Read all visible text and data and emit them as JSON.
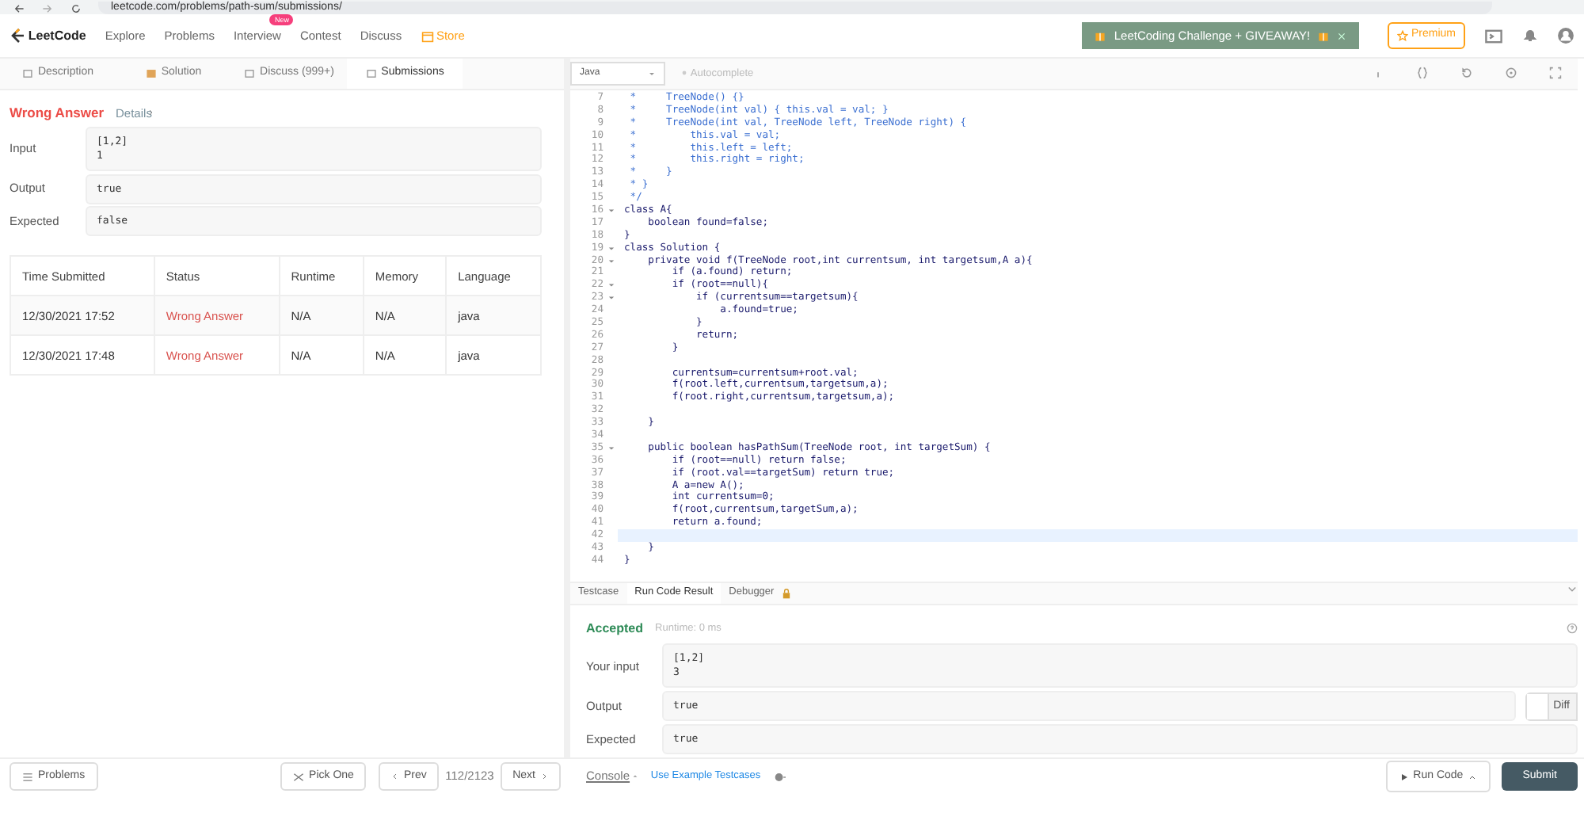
{
  "browser": {
    "url": "leetcode.com/problems/path-sum/submissions/"
  },
  "navbar": {
    "logo": "LeetCode",
    "items": [
      {
        "label": "Explore"
      },
      {
        "label": "Problems"
      },
      {
        "label": "Interview",
        "badge": "New"
      },
      {
        "label": "Contest"
      },
      {
        "label": "Discuss"
      },
      {
        "label": "Store",
        "kind": "store"
      }
    ],
    "banner": "LeetCoding Challenge + GIVEAWAY!",
    "premium": "Premium"
  },
  "tabs": [
    {
      "label": "Description",
      "selected": false
    },
    {
      "label": "Solution",
      "selected": false
    },
    {
      "label": "Discuss (999+)",
      "selected": false
    },
    {
      "label": "Submissions",
      "selected": true
    }
  ],
  "result": {
    "status": "Wrong Answer",
    "details": "Details",
    "fields": [
      {
        "label": "Input",
        "value": "[1,2]\n1"
      },
      {
        "label": "Output",
        "value": "true"
      },
      {
        "label": "Expected",
        "value": "false"
      }
    ]
  },
  "submissions": {
    "columns": [
      "Time Submitted",
      "Status",
      "Runtime",
      "Memory",
      "Language"
    ],
    "rows": [
      {
        "time": "12/30/2021 17:52",
        "status": "Wrong Answer",
        "runtime": "N/A",
        "memory": "N/A",
        "language": "java"
      },
      {
        "time": "12/30/2021 17:48",
        "status": "Wrong Answer",
        "runtime": "N/A",
        "memory": "N/A",
        "language": "java"
      }
    ]
  },
  "editor": {
    "language": "Java",
    "autocomplete": "Autocomplete",
    "lines": [
      {
        "number": "7",
        "kind": "comment",
        "text": " *     TreeNode() {}",
        "foldable": false,
        "active": false
      },
      {
        "number": "8",
        "kind": "comment",
        "text": " *     TreeNode(int val) { this.val = val; }",
        "foldable": false,
        "active": false
      },
      {
        "number": "9",
        "kind": "comment",
        "text": " *     TreeNode(int val, TreeNode left, TreeNode right) {",
        "foldable": false,
        "active": false
      },
      {
        "number": "10",
        "kind": "comment",
        "text": " *         this.val = val;",
        "foldable": false,
        "active": false
      },
      {
        "number": "11",
        "kind": "comment",
        "text": " *         this.left = left;",
        "foldable": false,
        "active": false
      },
      {
        "number": "12",
        "kind": "comment",
        "text": " *         this.right = right;",
        "foldable": false,
        "active": false
      },
      {
        "number": "13",
        "kind": "comment",
        "text": " *     }",
        "foldable": false,
        "active": false
      },
      {
        "number": "14",
        "kind": "comment",
        "text": " * }",
        "foldable": false,
        "active": false
      },
      {
        "number": "15",
        "kind": "comment",
        "text": " */",
        "foldable": false,
        "active": false
      },
      {
        "number": "16",
        "kind": "code",
        "text": "class A{",
        "foldable": true,
        "active": false
      },
      {
        "number": "17",
        "kind": "code",
        "text": "    boolean found=false;",
        "foldable": false,
        "active": false
      },
      {
        "number": "18",
        "kind": "code",
        "text": "}",
        "foldable": false,
        "active": false
      },
      {
        "number": "19",
        "kind": "code",
        "text": "class Solution {",
        "foldable": true,
        "active": false
      },
      {
        "number": "20",
        "kind": "code",
        "text": "    private void f(TreeNode root,int currentsum, int targetsum,A a){",
        "foldable": true,
        "active": false
      },
      {
        "number": "21",
        "kind": "code",
        "text": "        if (a.found) return;",
        "foldable": false,
        "active": false
      },
      {
        "number": "22",
        "kind": "code",
        "text": "        if (root==null){",
        "foldable": true,
        "active": false
      },
      {
        "number": "23",
        "kind": "code",
        "text": "            if (currentsum==targetsum){",
        "foldable": true,
        "active": false
      },
      {
        "number": "24",
        "kind": "code",
        "text": "                a.found=true;",
        "foldable": false,
        "active": false
      },
      {
        "number": "25",
        "kind": "code",
        "text": "            }",
        "foldable": false,
        "active": false
      },
      {
        "number": "26",
        "kind": "code",
        "text": "            return;",
        "foldable": false,
        "active": false
      },
      {
        "number": "27",
        "kind": "code",
        "text": "        }",
        "foldable": false,
        "active": false
      },
      {
        "number": "28",
        "kind": "code",
        "foldable": false,
        "active": false
      },
      {
        "number": "29",
        "kind": "code",
        "text": "        currentsum=currentsum+root.val;",
        "foldable": false,
        "active": false
      },
      {
        "number": "30",
        "kind": "code",
        "text": "        f(root.left,currentsum,targetsum,a);",
        "foldable": false,
        "active": false
      },
      {
        "number": "31",
        "kind": "code",
        "text": "        f(root.right,currentsum,targetsum,a);",
        "foldable": false,
        "active": false
      },
      {
        "number": "32",
        "kind": "code",
        "foldable": false,
        "active": false
      },
      {
        "number": "33",
        "kind": "code",
        "text": "    }",
        "foldable": false,
        "active": false
      },
      {
        "number": "34",
        "kind": "code",
        "foldable": false,
        "active": false
      },
      {
        "number": "35",
        "kind": "code",
        "text": "    public boolean hasPathSum(TreeNode root, int targetSum) {",
        "foldable": true,
        "active": false
      },
      {
        "number": "36",
        "kind": "code",
        "text": "        if (root==null) return false;",
        "foldable": false,
        "active": false
      },
      {
        "number": "37",
        "kind": "code",
        "text": "        if (root.val==targetSum) return true;",
        "foldable": false,
        "active": false
      },
      {
        "number": "38",
        "kind": "code",
        "text": "        A a=new A();",
        "foldable": false,
        "active": false
      },
      {
        "number": "39",
        "kind": "code",
        "text": "        int currentsum=0;",
        "foldable": false,
        "active": false
      },
      {
        "number": "40",
        "kind": "code",
        "text": "        f(root,currentsum,targetSum,a);",
        "foldable": false,
        "active": false
      },
      {
        "number": "41",
        "kind": "code",
        "text": "        return a.found;",
        "foldable": false,
        "active": false
      },
      {
        "number": "42",
        "kind": "code",
        "foldable": false,
        "active": true
      },
      {
        "number": "43",
        "kind": "code",
        "text": "    }",
        "foldable": false,
        "active": false
      },
      {
        "number": "44",
        "kind": "code",
        "text": "}",
        "foldable": false,
        "active": false
      }
    ]
  },
  "console": {
    "tabs": [
      {
        "label": "Testcase",
        "selected": false,
        "locked": false
      },
      {
        "label": "Run Code Result",
        "selected": true,
        "locked": false
      },
      {
        "label": "Debugger",
        "selected": false,
        "locked": true
      }
    ],
    "status": "Accepted",
    "runtime": "Runtime: 0 ms",
    "fields": [
      {
        "label": "Your input",
        "value": "[1,2]\n3"
      },
      {
        "label": "Output",
        "value": "true"
      },
      {
        "label": "Expected",
        "value": "true"
      }
    ],
    "diff": "Diff"
  },
  "footer": {
    "problems": "Problems",
    "pick_one": "Pick One",
    "prev": "Prev",
    "page": "112/2123",
    "next": "Next",
    "console": "Console",
    "example": "Use Example Testcases",
    "run_code": "Run Code",
    "submit": "Submit"
  }
}
